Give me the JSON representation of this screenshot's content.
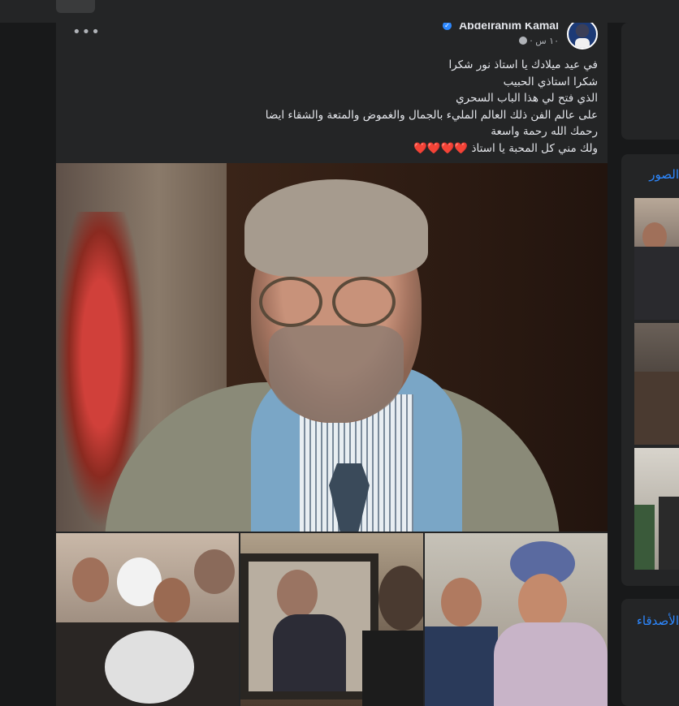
{
  "post": {
    "author": "Abdelrahim Kamal",
    "time": "١٠ س",
    "more_label": "•••",
    "lines": [
      "في عيد ميلادك يا استاذ نور شكرا",
      "شكرا استاذي الحبيب",
      "الذي فتح لي هذا الباب السحري",
      "على عالم الفن ذلك العالم المليء بالجمال والغموض والمتعة والشقاء ايضا",
      "رحمك الله رحمة واسعة",
      "ولك مني كل المحبة يا استاذ"
    ],
    "hearts": "❤️❤️❤️❤️"
  },
  "sidebar": {
    "photos_title": "الصور",
    "friends_title": "الأصدقاء"
  },
  "colors": {
    "background": "#18191a",
    "card": "#242526",
    "link": "#2d88ff",
    "text": "#e4e6eb",
    "secondary": "#b0b3b8"
  }
}
